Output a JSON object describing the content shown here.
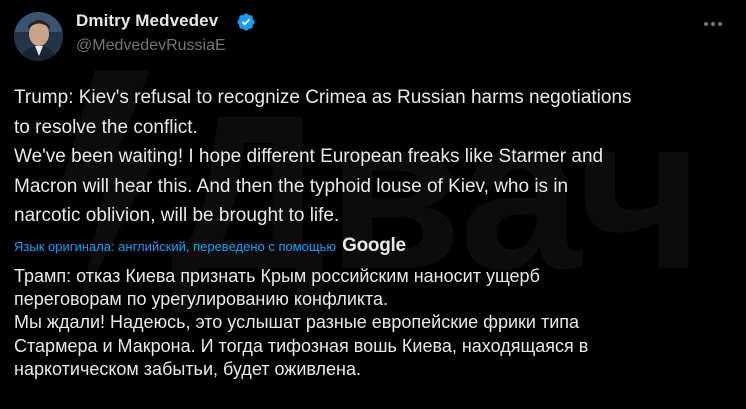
{
  "author": {
    "display_name": "Dmitry Medvedev",
    "handle": "@MedvedevRussiaE",
    "verified": true
  },
  "icons": {
    "verified": "verified-badge-icon",
    "more": "more-options-icon",
    "avatar": "avatar"
  },
  "tweet": {
    "text_en": "Trump: Kiev's refusal to recognize Crimea as Russian harms negotiations\nto resolve the conflict.\nWe've been waiting! I hope different European freaks like Starmer and\nMacron will hear this. And then the typhoid louse of Kiev, who is in\nnarcotic oblivion, will be brought to life.",
    "translation_note": "Язык оригинала: английский, переведено с помощью",
    "translation_provider": "Google",
    "text_ru": "Трамп: отказ Киева признать Крым российским наносит ущерб\nпереговорам по урегулированию конфликта.\nМы ждали! Надеюсь, это услышат разные европейские фрики типа\nСтармера и Макрона. И тогда тифозная вошь Киева, находящаяся в\nнаркотическом забытьи, будет оживлена."
  },
  "watermark": {
    "logo_text": "Двач"
  },
  "colors": {
    "background": "#000000",
    "text_primary": "#e7e9ea",
    "text_secondary": "#71767b",
    "link": "#1d9bf0",
    "verified": "#1d9bf0"
  }
}
